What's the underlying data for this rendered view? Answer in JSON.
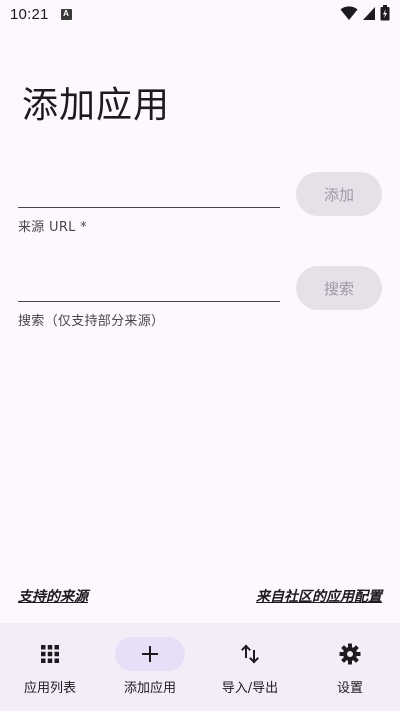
{
  "status_bar": {
    "time": "10:21",
    "notification_badge": "A",
    "icons": [
      "wifi-icon",
      "signal-icon",
      "battery-charging-icon"
    ]
  },
  "page": {
    "title": "添加应用"
  },
  "url_field": {
    "value": "",
    "helper": "来源 URL *",
    "button_label": "添加"
  },
  "search_field": {
    "value": "",
    "helper": "搜索（仅支持部分来源）",
    "button_label": "搜索"
  },
  "footer": {
    "supported_sources": "支持的来源",
    "community_configs": "来自社区的应用配置"
  },
  "bottom_nav": {
    "items": [
      {
        "label": "应用列表",
        "icon": "grid-icon",
        "active": false
      },
      {
        "label": "添加应用",
        "icon": "plus-icon",
        "active": true
      },
      {
        "label": "导入/导出",
        "icon": "import-export-icon",
        "active": false
      },
      {
        "label": "设置",
        "icon": "gear-icon",
        "active": false
      }
    ]
  },
  "colors": {
    "background": "#fdf7fe",
    "nav_background": "#f3edf7",
    "active_indicator": "#e8def8",
    "disabled_button": "#e6e0e9"
  }
}
